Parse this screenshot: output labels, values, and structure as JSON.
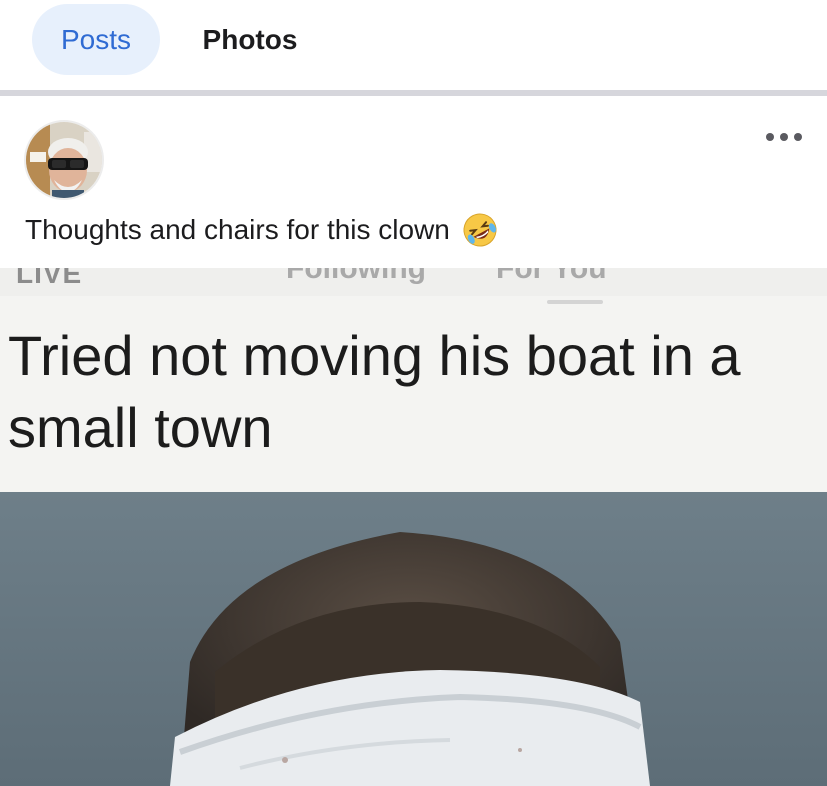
{
  "tabs": {
    "posts_label": "Posts",
    "photos_label": "Photos",
    "active_tab": "Posts"
  },
  "colors": {
    "active_tab_bg": "#e7f0fc",
    "active_tab_text": "#2f6bd3",
    "divider": "#d6d6dc"
  },
  "post": {
    "author_avatar": "avatar",
    "more_icon": "more-icon",
    "caption_text": "Thoughts and chairs for this clown",
    "caption_emoji_icon": "rolling-on-floor-laughing-icon",
    "media": {
      "overlay_live": "LIVE",
      "overlay_following": "Following",
      "overlay_for_you": "For You",
      "meme_caption": "Tried not moving his boat in a small town"
    }
  }
}
